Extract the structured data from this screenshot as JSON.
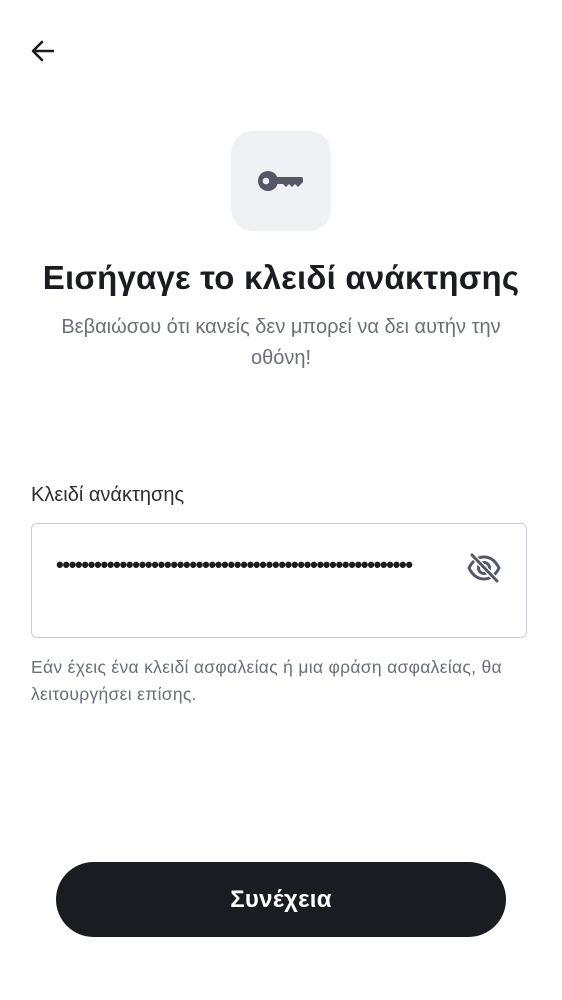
{
  "header": {
    "back_icon": "arrow-left-icon"
  },
  "hero": {
    "icon": "key-icon",
    "title": "Εισήγαγε το κλειδί ανάκτησης",
    "subtitle": "Βεβαιώσου ότι κανείς δεν μπορεί να δει αυτήν την οθόνη!"
  },
  "form": {
    "label": "Κλειδί ανάκτησης",
    "value": "••••••••••••••••••••••••••••••••••••••••••••••••••••••••",
    "visibility_icon": "eye-off-icon",
    "helper": "Εάν έχεις ένα κλειδί ασφαλείας ή μια φράση ασφαλείας, θα λειτουργήσει επίσης."
  },
  "footer": {
    "continue_label": "Συνέχεια"
  },
  "colors": {
    "text_primary": "#1a1c22",
    "text_secondary": "#6a6f7b",
    "icon_tile_bg": "#f0f1f5",
    "icon_color": "#545864",
    "field_border": "#c9ccd3",
    "button_bg": "#1a1c22",
    "button_text": "#ffffff"
  }
}
